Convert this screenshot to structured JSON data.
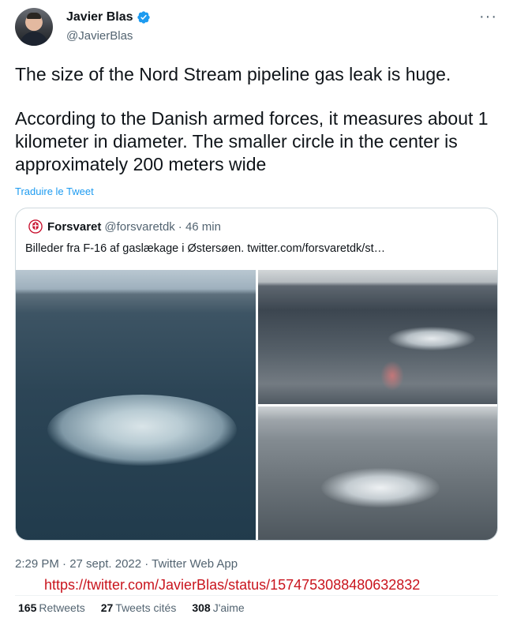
{
  "author": {
    "name": "Javier Blas",
    "handle": "@JavierBlas",
    "verified_icon": "verified-badge-icon",
    "more_icon": "more-options-icon"
  },
  "tweet": {
    "paragraph1": "The size of the Nord Stream pipeline gas leak is huge.",
    "paragraph2": "According to the Danish armed forces, it measures about 1 kilometer in diameter. The smaller circle in the center is approximately 200 meters wide",
    "translate_label": "Traduire le Tweet"
  },
  "quoted_tweet": {
    "name": "Forsvaret",
    "handle": "@forsvaretdk",
    "time": "· 46 min",
    "text": "Billeder fra F-16 af gaslækage i Østersøen.  twitter.com/forsvaretdk/st…",
    "logo_icon": "danish-defence-crest-icon",
    "images": [
      "aerial-sea-gas-leak-1",
      "aerial-sea-gas-leak-2",
      "aerial-sea-gas-leak-3"
    ]
  },
  "meta": {
    "timestamp": "2:29 PM · 27 sept. 2022 · Twitter Web App",
    "url_overlay": "https://twitter.com/JavierBlas/status/1574753088480632832"
  },
  "stats": {
    "retweets_count": "165",
    "retweets_label": "Retweets",
    "quotes_count": "27",
    "quotes_label": "Tweets cités",
    "likes_count": "308",
    "likes_label": "J'aime"
  },
  "colors": {
    "link_blue": "#1d9bf0",
    "secondary_text": "#536471",
    "url_overlay_red": "#c9141d"
  }
}
